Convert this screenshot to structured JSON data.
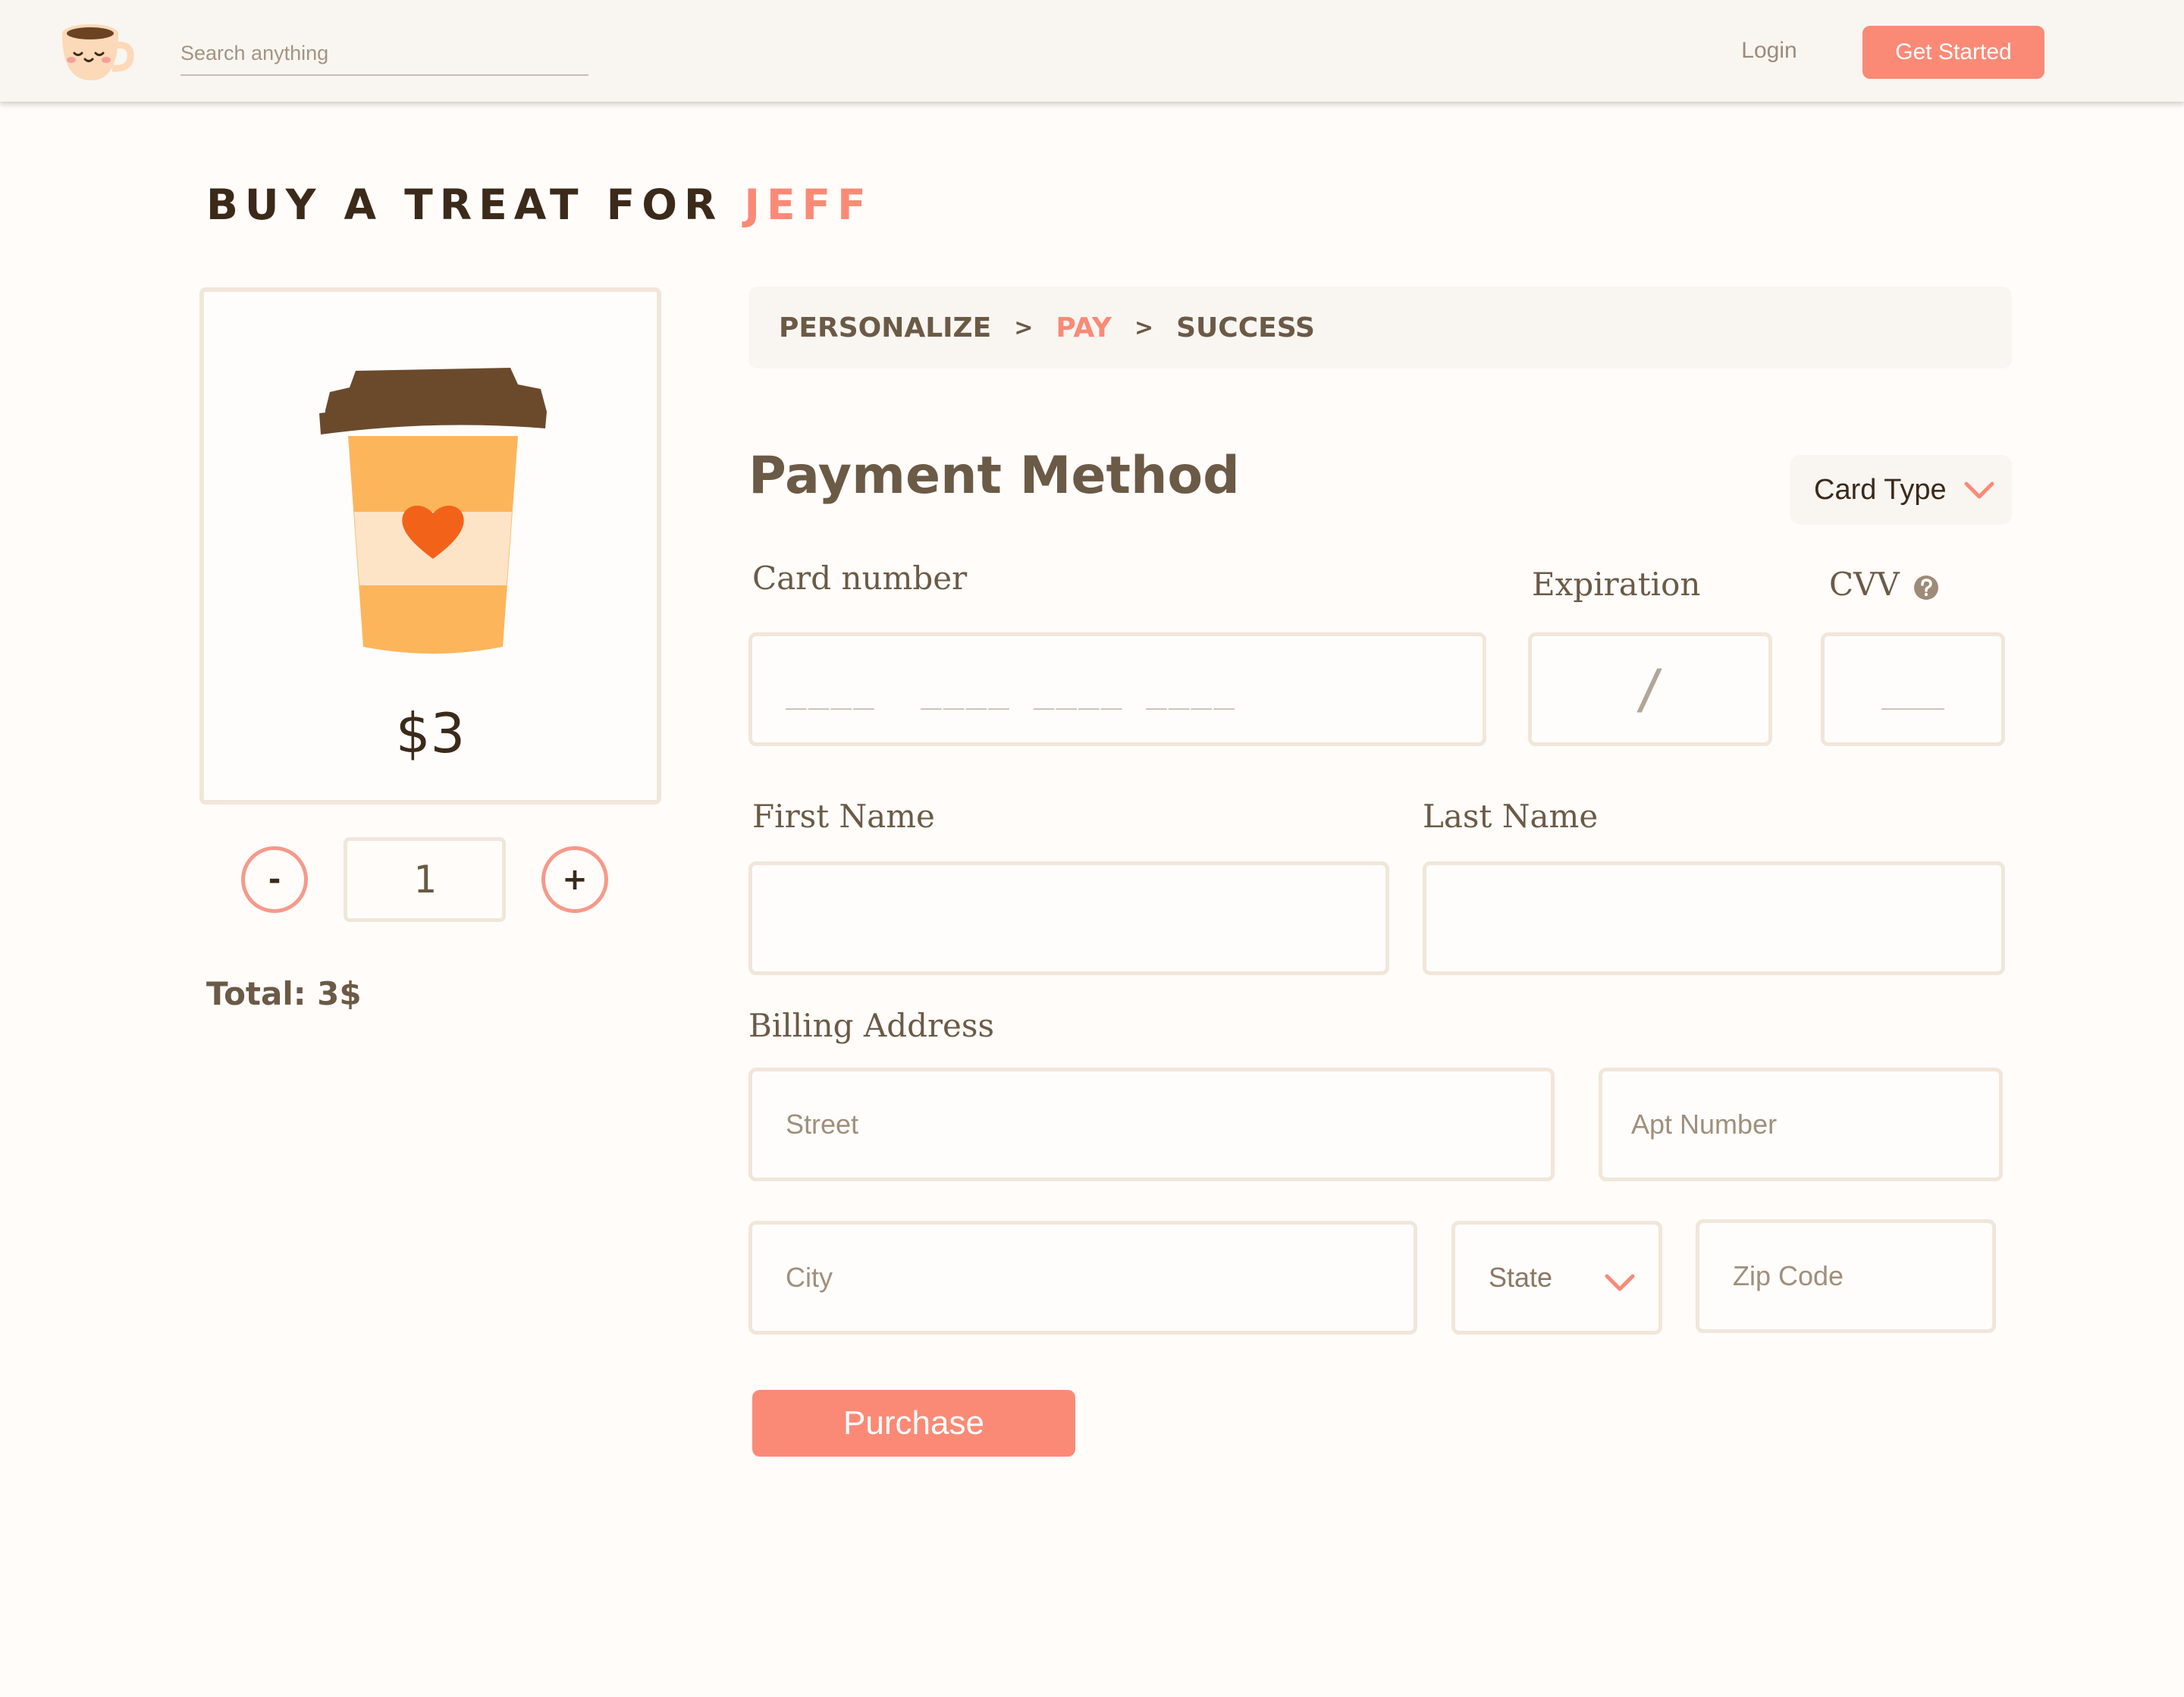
{
  "header": {
    "search_placeholder": "Search anything",
    "login_label": "Login",
    "get_started_label": "Get Started"
  },
  "title": {
    "prefix": "BUY A TREAT FOR ",
    "name": "JEFF"
  },
  "product": {
    "image": "coffee-cup-heart-icon",
    "price": "$3",
    "quantity": "1",
    "minus_label": "-",
    "plus_label": "+",
    "total": "Total: 3$"
  },
  "steps": {
    "items": [
      "PERSONALIZE",
      "PAY",
      "SUCCESS"
    ],
    "separator": ">",
    "current": "PAY"
  },
  "payment": {
    "title": "Payment Method",
    "card_type_label": "Card Type",
    "card_number_label": "Card number",
    "card_number_mask": "____  ____ ____ ____",
    "expiration_label": "Expiration",
    "expiration_mask": "/",
    "cvv_label": "CVV",
    "cvv_mask": "___",
    "first_name_label": "First Name",
    "last_name_label": "Last Name"
  },
  "billing": {
    "title": "Billing Address",
    "street_placeholder": "Street",
    "apt_placeholder": "Apt Number",
    "city_placeholder": "City",
    "state_label": "State",
    "zip_placeholder": "Zip Code"
  },
  "purchase_label": "Purchase",
  "colors": {
    "accent": "#fa8a76",
    "border": "#f1e6da",
    "text": "#6b5a46",
    "dark_text": "#3b2a1a",
    "panel": "#f9f6f2"
  }
}
